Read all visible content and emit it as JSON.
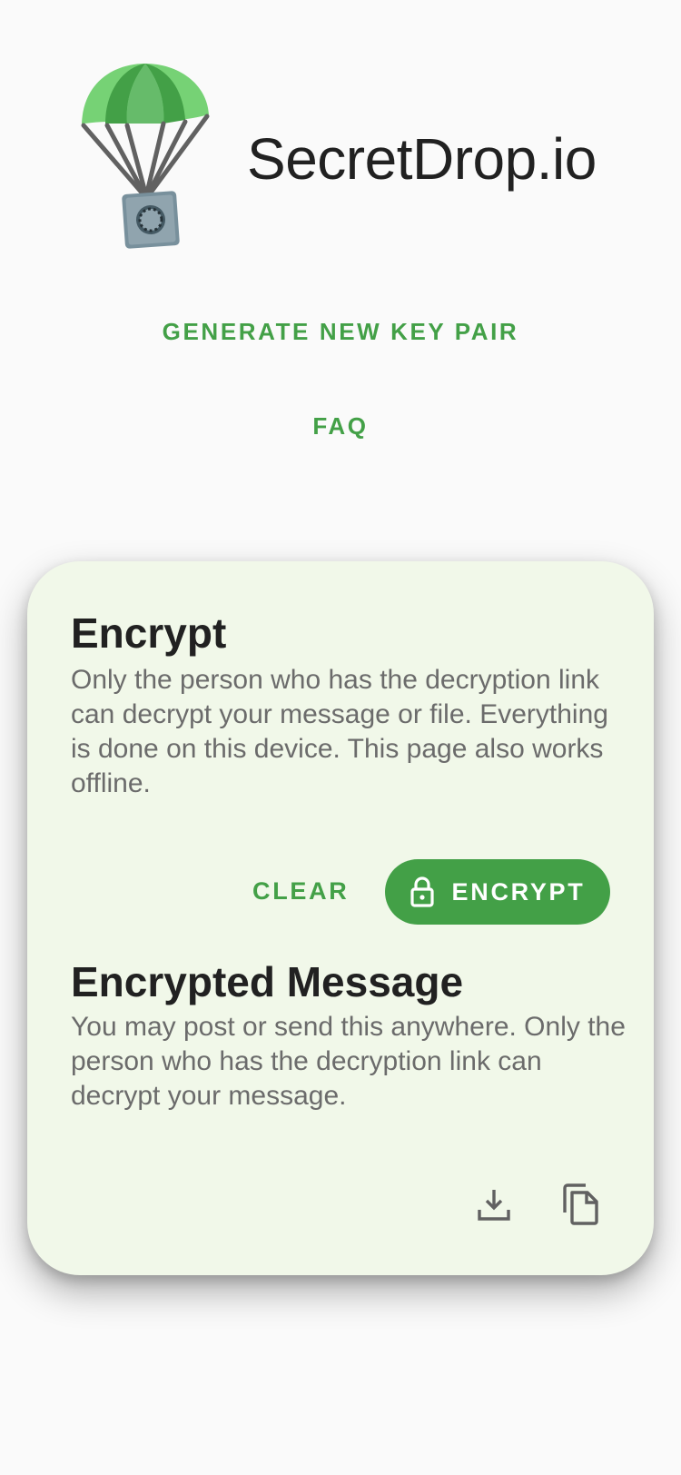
{
  "app": {
    "title": "SecretDrop.io",
    "logo_icon": "parachute-safe-logo"
  },
  "nav": {
    "generate_label": "GENERATE NEW KEY PAIR",
    "faq_label": "FAQ"
  },
  "encrypt_section": {
    "title": "Encrypt",
    "description": "Only the person who has the decryption link can decrypt your message or file. Everything is done on this device. This page also works offline.",
    "clear_label": "CLEAR",
    "encrypt_label": "ENCRYPT",
    "encrypt_icon": "lock-icon"
  },
  "encrypted_section": {
    "title": "Encrypted Message",
    "description": "You may post or send this anywhere. Only the person who has the decryption link can decrypt your message.",
    "download_icon": "download-icon",
    "copy_icon": "copy-icon"
  },
  "colors": {
    "accent": "#43a047",
    "background": "#fafafa",
    "card": "#f1f8e9",
    "text_primary": "#212121",
    "text_secondary": "#6b6b6b"
  }
}
